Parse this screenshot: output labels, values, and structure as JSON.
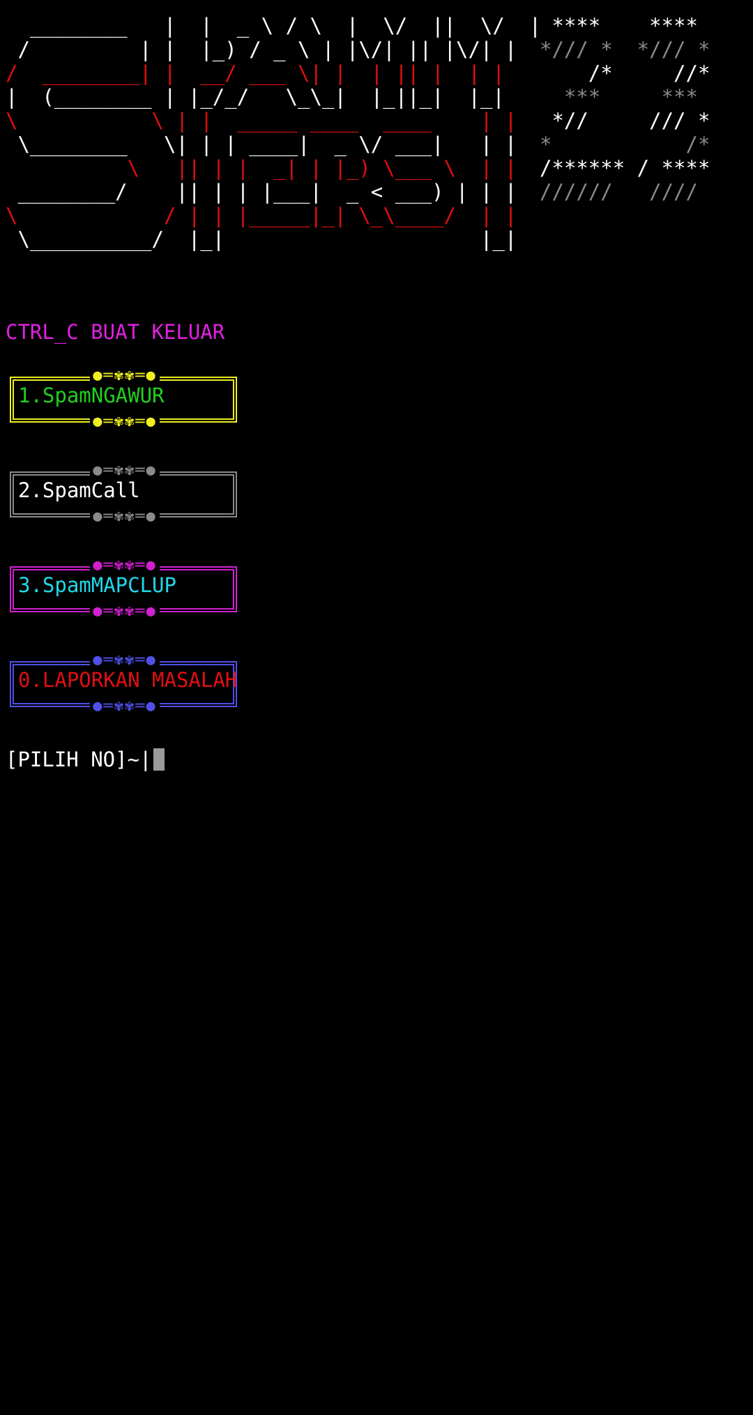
{
  "banner": {
    "logo_lines": [
      {
        "text": "  ________   |  |  _ \\ / \\  |  \\/  ||  \\/  |",
        "color": "white"
      },
      {
        "text": " /         | |  |_) / _ \\ | |\\/| || |\\/| |",
        "color": "white"
      },
      {
        "text": "/  ________| |  __/ ___ \\| |  | || |  | |",
        "color": "red"
      },
      {
        "text": "|  (________ | |_/_/   \\_\\_|  |_||_|  |_|",
        "color": "white"
      },
      {
        "text": "\\           \\ | |  _____ ____  ____    | |",
        "color": "red"
      },
      {
        "text": " \\________   \\| | | ____|  _ \\/ ___|   | |",
        "color": "white"
      },
      {
        "text": "          \\   || | |  _| | |_) \\___ \\  | |",
        "color": "red"
      },
      {
        "text": " ________/    || | | |___|  _ < ___) | | |",
        "color": "white"
      },
      {
        "text": "\\            / | | |_____|_| \\_\\____/  | |",
        "color": "red"
      },
      {
        "text": " \\__________/  |_|                     |_|",
        "color": "white"
      }
    ],
    "art_lines": [
      {
        "text": " ****    ****",
        "color": "white"
      },
      {
        "text": "*/// *  */// *",
        "color": "gray"
      },
      {
        "text": "    /*     //*",
        "color": "white"
      },
      {
        "text": "  ***     ***",
        "color": "gray"
      },
      {
        "text": " *//     /// *",
        "color": "white"
      },
      {
        "text": "*           /*",
        "color": "gray"
      },
      {
        "text": "/****** / ****",
        "color": "white"
      },
      {
        "text": "//////   ////",
        "color": "gray"
      }
    ]
  },
  "ctrl_hint": "CTRL_C BUAT KELUAR",
  "menu": [
    {
      "label": "1.SpamNGAWUR",
      "frame_color": "#f0f020",
      "text_color": "#20d020",
      "ornament": "●═✾✾═●"
    },
    {
      "label": "2.SpamCall",
      "frame_color": "#8a8a8a",
      "text_color": "#ffffff",
      "ornament": "●═✾✾═●"
    },
    {
      "label": "3.SpamMAPCLUP",
      "frame_color": "#d020d0",
      "text_color": "#20d8e8",
      "ornament": "●═✾✾═●"
    },
    {
      "label": "0.LAPORKAN MASALAH",
      "frame_color": "#5050e8",
      "text_color": "#e01010",
      "ornament": "●═✾✾═●"
    }
  ],
  "prompt": "[PILIH NO]~|",
  "colors": {
    "background": "#000000",
    "hint": "#e020e0",
    "cursor": "#9a9a9a"
  }
}
